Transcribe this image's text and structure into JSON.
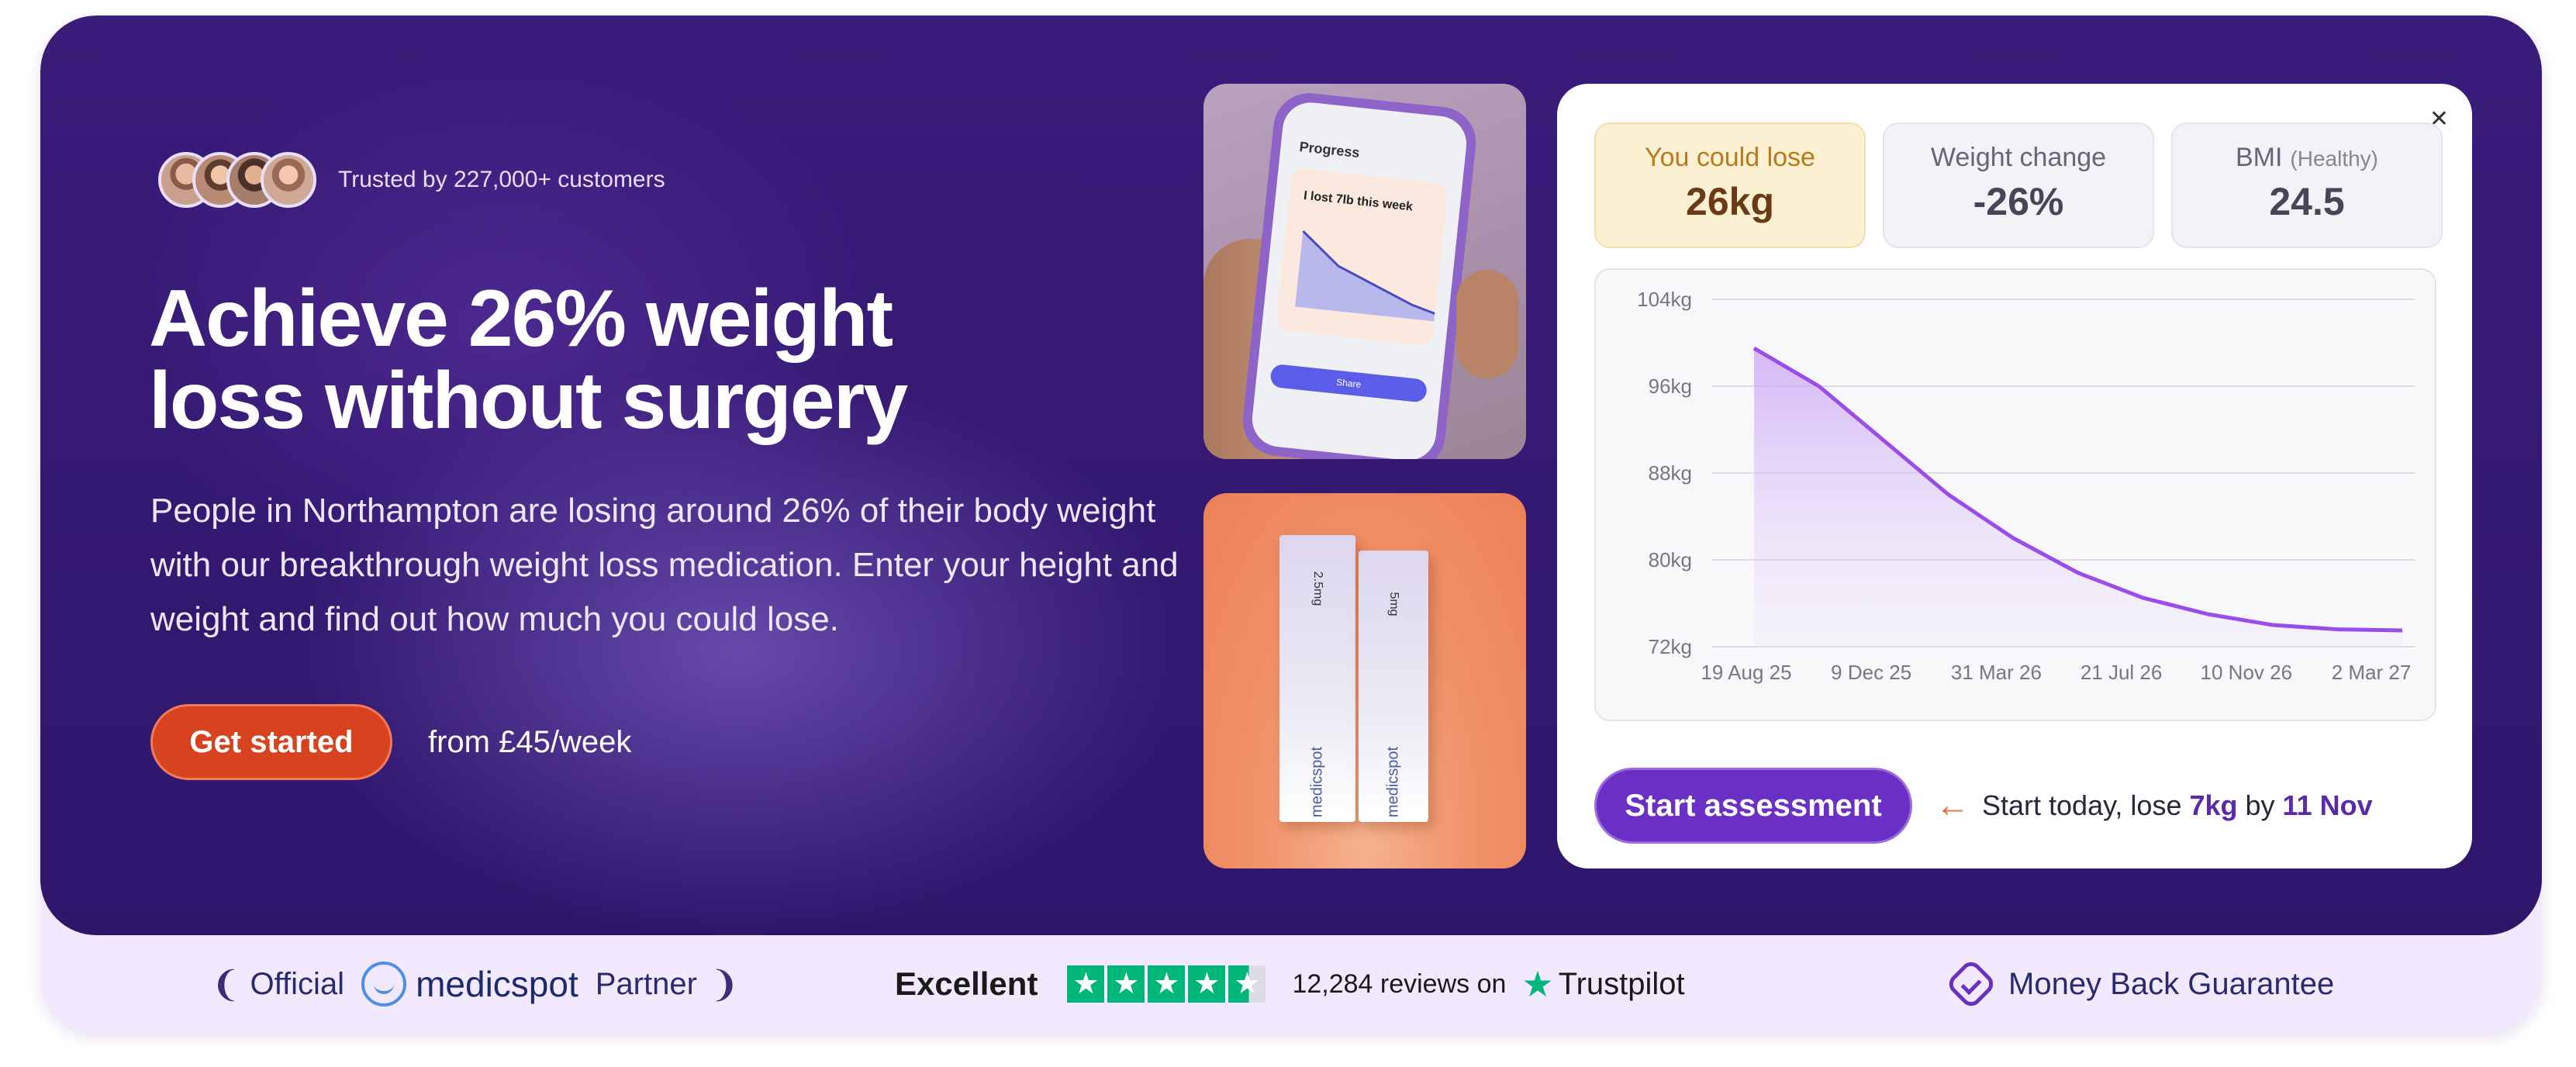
{
  "hero": {
    "trusted": "Trusted by 227,000+ customers",
    "headline_line1": "Achieve 26% weight",
    "headline_line2": "loss without surgery",
    "body": "People in Northampton are losing around 26% of their body weight with our breakthrough weight loss medication. Enter your height and weight and find out how much you could lose.",
    "cta_label": "Get started",
    "price": "from £45/week"
  },
  "images": {
    "phone_title": "Progress",
    "phone_heading": "I lost 7lb this week",
    "phone_share": "Share",
    "box_brand": "medicspot",
    "box_dose_1": "2.5mg",
    "box_dose_2": "5mg"
  },
  "panel": {
    "close_icon": "close-icon",
    "stats": [
      {
        "label": "You could lose",
        "sub": "",
        "value": "26kg"
      },
      {
        "label": "Weight change",
        "sub": "",
        "value": "-26%"
      },
      {
        "label": "BMI",
        "sub": "(Healthy)",
        "value": "24.5"
      }
    ],
    "cta_label": "Start assessment",
    "note_prefix": "Start today, lose ",
    "note_amount": "7kg",
    "note_mid": " by ",
    "note_date": "11 Nov"
  },
  "chart_data": {
    "type": "area",
    "title": "",
    "xlabel": "",
    "ylabel": "",
    "y_ticks": [
      "104kg",
      "96kg",
      "88kg",
      "80kg",
      "72kg"
    ],
    "y_tick_values": [
      104,
      96,
      88,
      80,
      72
    ],
    "x_ticks": [
      "19 Aug 25",
      "9 Dec 25",
      "31 Mar 26",
      "21 Jul 26",
      "10 Nov 26",
      "2 Mar 27"
    ],
    "ylim": [
      72,
      104
    ],
    "grid": true,
    "series": [
      {
        "color": "#9b4dea",
        "x": [
          "19 Aug 25",
          "9 Oct 25",
          "9 Dec 25",
          "6 Feb 26",
          "31 Mar 26",
          "26 May 26",
          "21 Jul 26",
          "16 Sep 26",
          "10 Nov 26",
          "6 Jan 27",
          "2 Mar 27"
        ],
        "values": [
          99.5,
          96.0,
          91.0,
          86.0,
          82.0,
          78.8,
          76.5,
          75.0,
          74.0,
          73.6,
          73.5
        ]
      }
    ]
  },
  "bottom": {
    "official": "Official",
    "brand": "medicspot",
    "partner": "Partner",
    "excellent": "Excellent",
    "rating_stars": 4.5,
    "reviews": "12,284 reviews on",
    "trustpilot": "Trustpilot",
    "guarantee": "Money Back Guarantee"
  },
  "colors": {
    "hero_bg": "#2f166b",
    "cta_orange": "#d7431f",
    "cta_purple": "#6a2fc4",
    "trustpilot_green": "#00b67a",
    "line": "#9b4dea"
  }
}
